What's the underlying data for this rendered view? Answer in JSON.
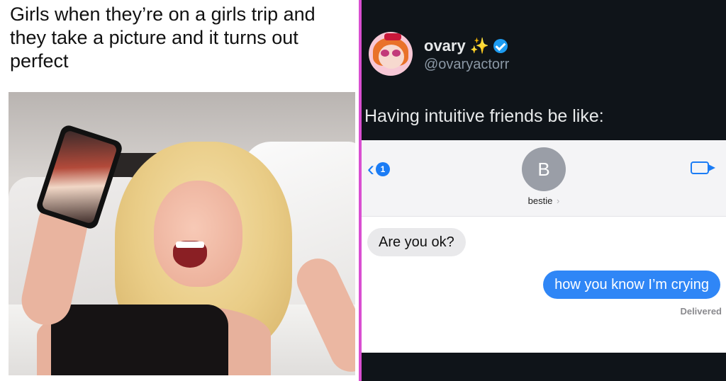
{
  "left_panel": {
    "caption": "Girls when they’re on a girls trip and they take a picture and it turns out perfect"
  },
  "right_panel": {
    "display_name": "ovary",
    "emoji": "✨",
    "handle": "@ovaryactorr",
    "tweet_text": "Having intuitive friends be like:",
    "sms": {
      "back_count": "1",
      "contact_initial": "B",
      "contact_name": "bestie",
      "contact_chevron": "›",
      "incoming_message": "Are you ok?",
      "outgoing_message": "how you know I’m crying",
      "status": "Delivered"
    }
  },
  "colors": {
    "divider": "#d94fd1",
    "tweet_bg": "#0f1419",
    "imessage_blue": "#2f86f6",
    "verified_blue": "#1d9bf0"
  }
}
